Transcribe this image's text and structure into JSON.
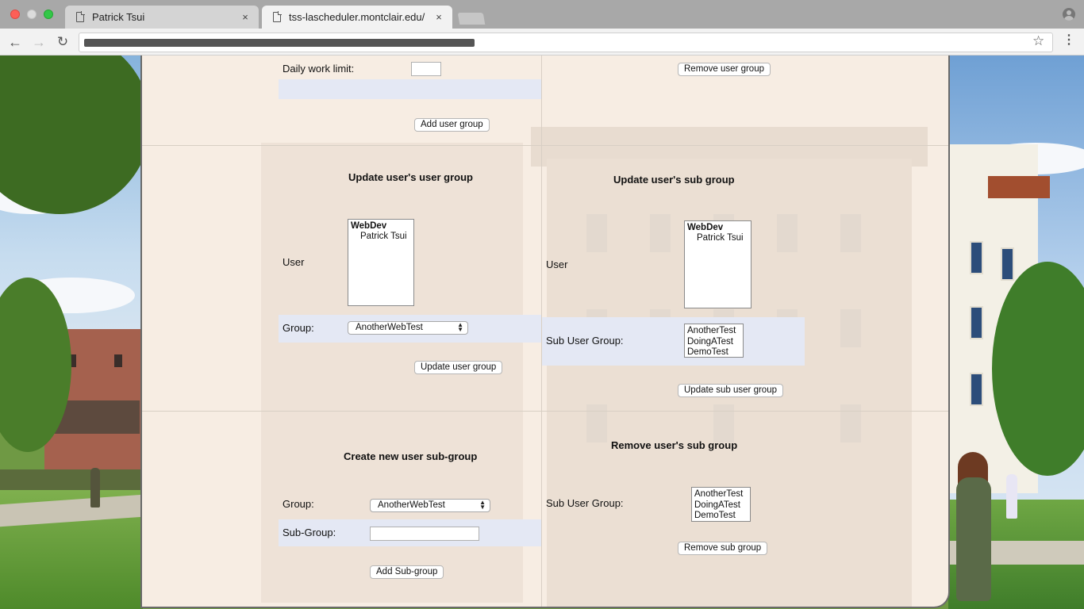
{
  "browser": {
    "tabs": [
      {
        "title": "Patrick Tsui",
        "close": "×"
      },
      {
        "title": "tss-lascheduler.montclair.edu/",
        "close": "×"
      }
    ],
    "nav": {
      "back": "←",
      "forward": "→",
      "reload": "↻"
    },
    "star": "☆",
    "menu": "⋮"
  },
  "top_section": {
    "daily_work_limit_label": "Daily work limit:",
    "daily_work_limit_value": "",
    "add_user_group_button": "Add user group",
    "remove_user_group_button": "Remove user group"
  },
  "update_user_group": {
    "title": "Update user's user group",
    "user_label": "User",
    "user_list": {
      "group": "WebDev",
      "items": [
        "Patrick Tsui"
      ]
    },
    "group_label": "Group:",
    "group_selected": "AnotherWebTest",
    "button": "Update user group"
  },
  "update_sub_group": {
    "title": "Update user's sub group",
    "user_label": "User",
    "user_list": {
      "group": "WebDev",
      "items": [
        "Patrick Tsui"
      ]
    },
    "sub_group_label": "Sub User Group:",
    "sub_groups": [
      "AnotherTest",
      "DoingATest",
      "DemoTest"
    ],
    "button": "Update sub user group"
  },
  "create_sub_group": {
    "title": "Create new user sub-group",
    "group_label": "Group:",
    "group_selected": "AnotherWebTest",
    "sub_group_label": "Sub-Group:",
    "sub_group_value": "",
    "button": "Add Sub-group"
  },
  "remove_sub_group": {
    "title": "Remove user's sub group",
    "sub_group_label": "Sub User Group:",
    "sub_groups": [
      "AnotherTest",
      "DoingATest",
      "DemoTest"
    ],
    "button": "Remove sub group"
  }
}
